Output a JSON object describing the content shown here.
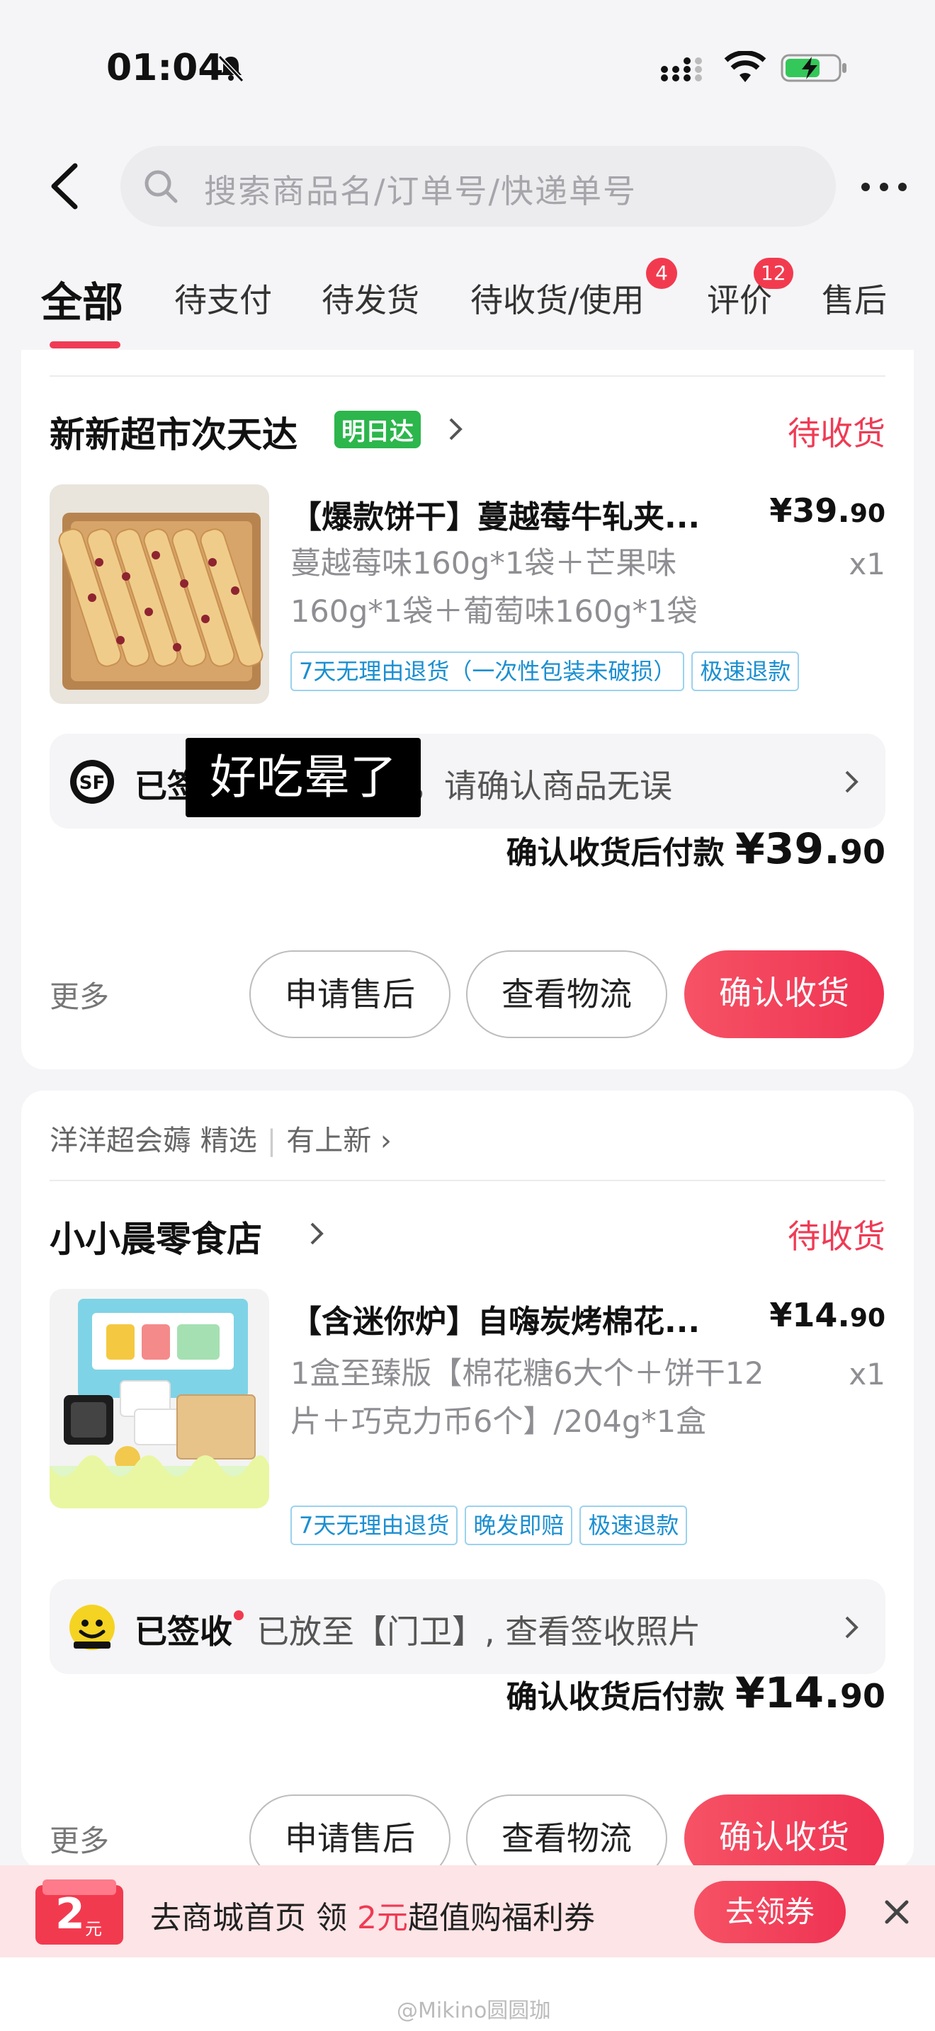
{
  "status_bar": {
    "time": "01:04"
  },
  "search": {
    "placeholder": "搜索商品名/订单号/快递单号"
  },
  "tabs": [
    {
      "label": "全部",
      "active": true
    },
    {
      "label": "待支付"
    },
    {
      "label": "待发货"
    },
    {
      "label": "待收货/使用",
      "badge": "4"
    },
    {
      "label": "评价",
      "badge": "12"
    },
    {
      "label": "售后"
    }
  ],
  "orders": [
    {
      "shop": "新新超市次天达",
      "shop_tag": "明日达",
      "status": "待收货",
      "product_title": "【爆款饼干】蔓越莓牛轧夹...",
      "price_main": "¥39.",
      "price_dec": "90",
      "spec": "蔓越莓味160g*1袋＋芒果味160g*1袋＋葡萄味160g*1袋",
      "qty": "x1",
      "tags": [
        "7天无理由退货（一次性包装未破损）",
        "极速退款"
      ],
      "logistics_status": "已签",
      "logistics_text": "卫】，请确认商品无误",
      "pay_label": "确认收货后付款",
      "pay_main": "¥39.",
      "pay_dec": "90",
      "more": "更多",
      "buttons": [
        "申请售后",
        "查看物流",
        "确认收货"
      ]
    },
    {
      "platform": "洋洋超会薅 精选",
      "platform_new": "有上新",
      "shop": "小小晨零食店",
      "status": "待收货",
      "product_title": "【含迷你炉】自嗨炭烤棉花...",
      "price_main": "¥14.",
      "price_dec": "90",
      "spec": "1盒至臻版【棉花糖6大个＋饼干12片＋巧克力币6个】/204g*1盒",
      "qty": "x1",
      "tags": [
        "7天无理由退货",
        "晚发即赔",
        "极速退款"
      ],
      "logistics_status": "已签收",
      "logistics_text": "已放至【门卫】, 查看签收照片",
      "pay_label": "确认收货后付款",
      "pay_main": "¥14.",
      "pay_dec": "90",
      "more": "更多",
      "buttons": [
        "申请售后",
        "查看物流",
        "确认收货"
      ]
    }
  ],
  "overlay_caption": "好吃晕了",
  "promo": {
    "coupon_amount": "2",
    "coupon_unit": "元",
    "text_before": "去商城首页 领 ",
    "text_highlight": "2元",
    "text_after": "超值购福利券",
    "button": "去领券"
  },
  "watermark": "@Mikino圆圆珈",
  "colors": {
    "accent": "#ef3b55",
    "green_tag": "#2cb64c",
    "tag_blue": "#1b8fd1"
  }
}
